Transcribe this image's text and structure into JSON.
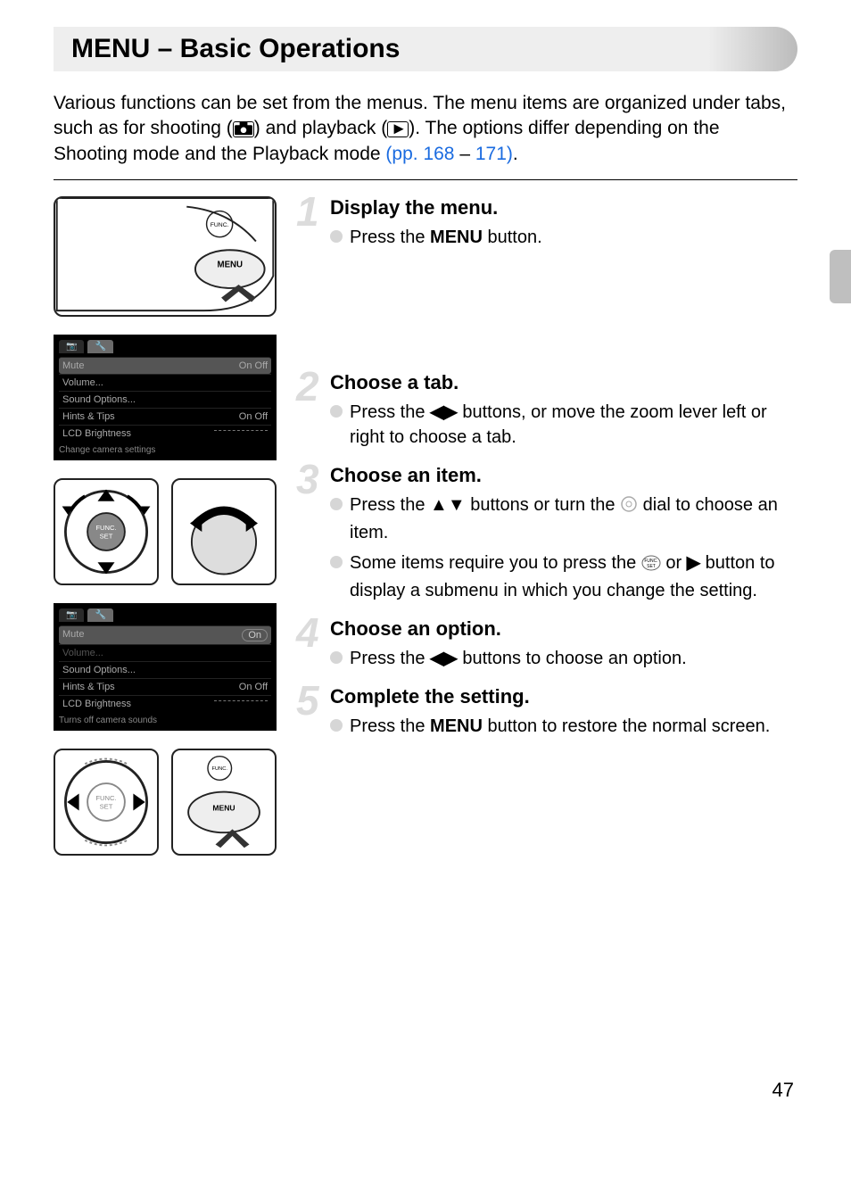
{
  "page": {
    "title": "MENU – Basic Operations",
    "intro_pre": "Various functions can be set from the menus. The menu items are organized under tabs, such as for shooting (",
    "intro_mid": ") and playback (",
    "intro_post": "). The options differ depending on the Shooting mode and the Playback mode ",
    "link_pp": "(pp. 168",
    "link_dash": " – ",
    "link_end": "171)",
    "link_tail": ".",
    "page_number": "47"
  },
  "steps": [
    {
      "num": "1",
      "title": "Display the menu.",
      "bullets": [
        {
          "pre": "Press the ",
          "glyph": "MENU",
          "post": " button."
        }
      ]
    },
    {
      "num": "2",
      "title": "Choose a tab.",
      "bullets": [
        {
          "pre": "Press the ",
          "glyph": "◀▶",
          "post": " buttons, or move the zoom lever left or right to choose a tab."
        }
      ]
    },
    {
      "num": "3",
      "title": "Choose an item.",
      "bullets": [
        {
          "pre": "Press the ",
          "glyph": "▲▼",
          "post": " buttons or turn the ",
          "glyph2": "dial",
          "post2": " dial to choose an item."
        },
        {
          "pre": "Some items require you to press the ",
          "glyph": "funcset",
          "post": " or ",
          "glyph2": "▶",
          "post2": " button to display a submenu in which you change the setting."
        }
      ]
    },
    {
      "num": "4",
      "title": "Choose an option.",
      "bullets": [
        {
          "pre": "Press the ",
          "glyph": "◀▶",
          "post": " buttons to choose an option."
        }
      ]
    },
    {
      "num": "5",
      "title": "Complete the setting.",
      "bullets": [
        {
          "pre": "Press the ",
          "glyph": "MENU",
          "post": " button to restore the normal screen."
        }
      ]
    }
  ],
  "menu_shot_a": {
    "tab1": "📷",
    "tab2": "🔧",
    "rows": [
      {
        "label": "Mute",
        "value": "On   Off",
        "hl": true
      },
      {
        "label": "Volume...",
        "value": ""
      },
      {
        "label": "Sound Options...",
        "value": ""
      },
      {
        "label": "Hints & Tips",
        "value": "On   Off"
      },
      {
        "label": "LCD Brightness",
        "value": "slider"
      }
    ],
    "caption": "Change camera settings"
  },
  "menu_shot_b": {
    "tab1": "📷",
    "tab2": "🔧",
    "rows": [
      {
        "label": "Mute",
        "value": "On",
        "pill": true,
        "hl": true
      },
      {
        "label": "Volume...",
        "value": "",
        "dim": true
      },
      {
        "label": "Sound Options...",
        "value": ""
      },
      {
        "label": "Hints & Tips",
        "value": "On   Off"
      },
      {
        "label": "LCD Brightness",
        "value": "slider"
      }
    ],
    "caption": "Turns off camera sounds"
  },
  "icons": {
    "camera": "camera-icon",
    "play": "play-icon",
    "menu_button": "MENU",
    "func_set": "FUNC. SET"
  }
}
